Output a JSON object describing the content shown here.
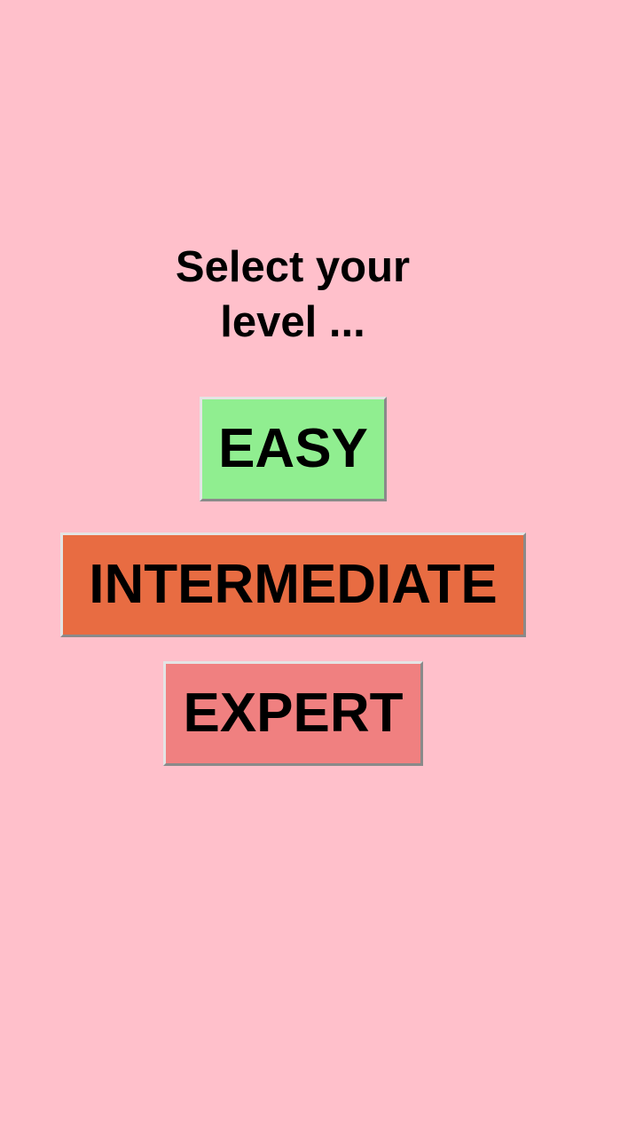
{
  "prompt": {
    "line1": "Select your",
    "line2": "level ..."
  },
  "levels": [
    {
      "label": "EASY",
      "color": "#90ee90"
    },
    {
      "label": "INTERMEDIATE",
      "color": "#e86c42"
    },
    {
      "label": "EXPERT",
      "color": "#f08080"
    }
  ],
  "colors": {
    "background": "#ffc0cb"
  }
}
